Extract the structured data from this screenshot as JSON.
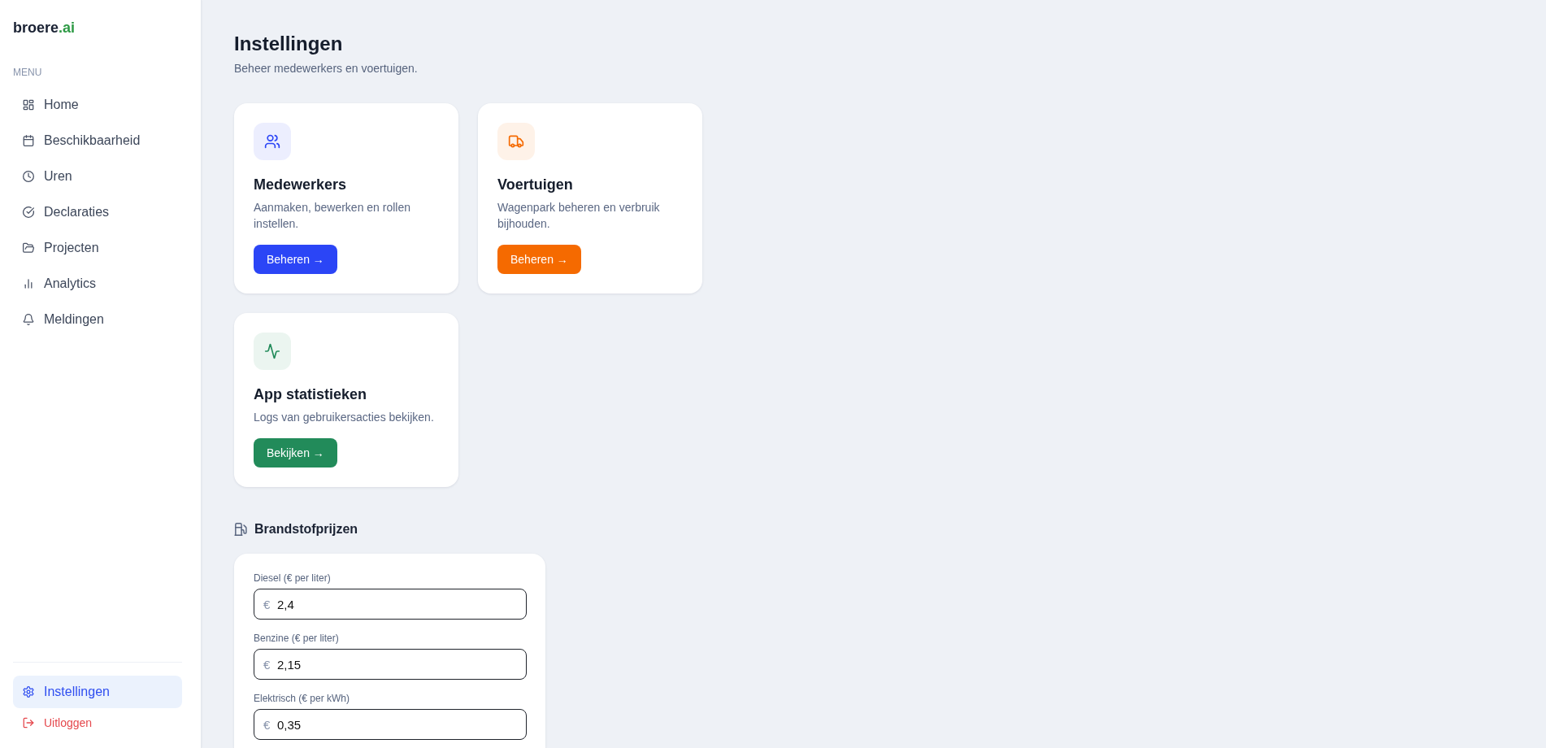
{
  "sidebar": {
    "logo": {
      "text": "broere",
      "accent": ".ai"
    },
    "section_label": "MENU",
    "items": [
      {
        "label": "Home",
        "selected": false
      },
      {
        "label": "Beschikbaarheid",
        "selected": false
      },
      {
        "label": "Uren",
        "selected": false
      },
      {
        "label": "Declaraties",
        "selected": false
      },
      {
        "label": "Projecten",
        "selected": false
      },
      {
        "label": "Analytics",
        "selected": false
      },
      {
        "label": "Meldingen",
        "selected": false
      }
    ],
    "footer_items": [
      {
        "kind": "nav",
        "label": "Instellingen",
        "selected": true
      },
      {
        "kind": "logout",
        "label": "Uitloggen"
      }
    ]
  },
  "page": {
    "title": "Instellingen",
    "subtitle": "Beheer medewerkers en voertuigen."
  },
  "cards": [
    {
      "title": "Medewerkers",
      "description": "Aanmaken, bewerken en rollen instellen.",
      "button": "Beheren →",
      "color": "#2b45f6"
    },
    {
      "title": "Voertuigen",
      "description": "Wagenpark beheren en verbruik bijhouden.",
      "button": "Beheren →",
      "color": "#f56a00"
    },
    {
      "title": "App statistieken",
      "description": "Logs van gebruikersacties bekijken.",
      "button": "Bekijken →",
      "color": "#228b5a"
    }
  ],
  "fuel_prices": {
    "title": "Brandstofprijzen",
    "fields": [
      {
        "label": "Diesel (€ per liter)",
        "prefix": "€",
        "value": "2,4"
      },
      {
        "label": "Benzine (€ per liter)",
        "prefix": "€",
        "value": "2,15"
      },
      {
        "label": "Elektrisch (€ per kWh)",
        "prefix": "€",
        "value": "0,35"
      }
    ]
  }
}
